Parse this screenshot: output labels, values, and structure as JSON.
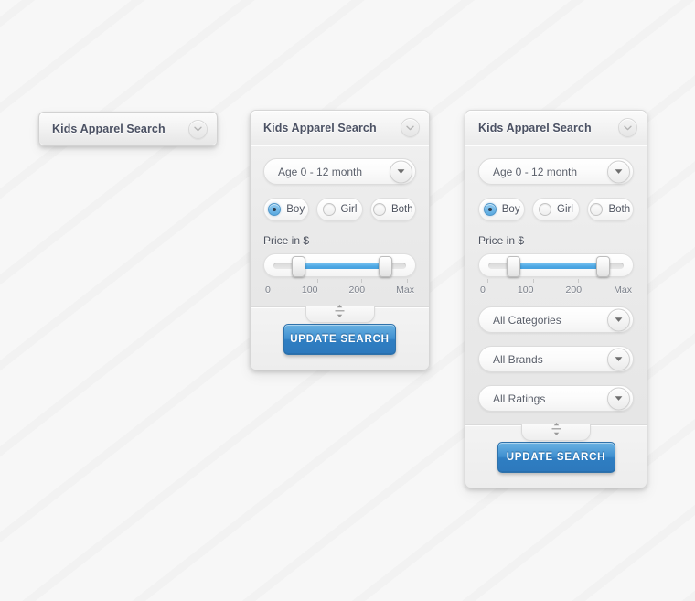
{
  "panels": {
    "collapsed": {
      "title": "Kids Apparel Search",
      "chevron_icon": "chevron-down-icon"
    },
    "medium": {
      "title": "Kids Apparel Search",
      "chevron_icon": "chevron-down-icon",
      "age_select": {
        "value": "Age 0 - 12 month",
        "arrow_icon": "caret-down-icon"
      },
      "gender": {
        "options": [
          {
            "label": "Boy",
            "checked": true
          },
          {
            "label": "Girl",
            "checked": false
          },
          {
            "label": "Both",
            "checked": false
          }
        ]
      },
      "price": {
        "caption": "Price in $",
        "scale": [
          "0",
          "100",
          "200",
          "Max"
        ],
        "min_percent": 18,
        "max_percent": 84,
        "fill_color": "#4ea8e4"
      },
      "resize_icon": "vertical-resize-icon",
      "update_label": "UPDATE SEARCH"
    },
    "full": {
      "title": "Kids Apparel Search",
      "chevron_icon": "chevron-down-icon",
      "age_select": {
        "value": "Age 0 - 12 month",
        "arrow_icon": "caret-down-icon"
      },
      "gender": {
        "options": [
          {
            "label": "Boy",
            "checked": true
          },
          {
            "label": "Girl",
            "checked": false
          },
          {
            "label": "Both",
            "checked": false
          }
        ]
      },
      "price": {
        "caption": "Price in $",
        "scale": [
          "0",
          "100",
          "200",
          "Max"
        ],
        "min_percent": 18,
        "max_percent": 84,
        "fill_color": "#4ea8e4"
      },
      "filters": [
        {
          "value": "All Categories",
          "arrow_icon": "caret-down-icon"
        },
        {
          "value": "All Brands",
          "arrow_icon": "caret-down-icon"
        },
        {
          "value": "All Ratings",
          "arrow_icon": "caret-down-icon"
        }
      ],
      "resize_icon": "vertical-resize-icon",
      "update_label": "UPDATE SEARCH"
    }
  },
  "theme": {
    "accent": "#2f7ec2",
    "slider_fill": "#4ea8e4",
    "title_color": "#4b5163",
    "page_background": "#f7f7f7"
  }
}
